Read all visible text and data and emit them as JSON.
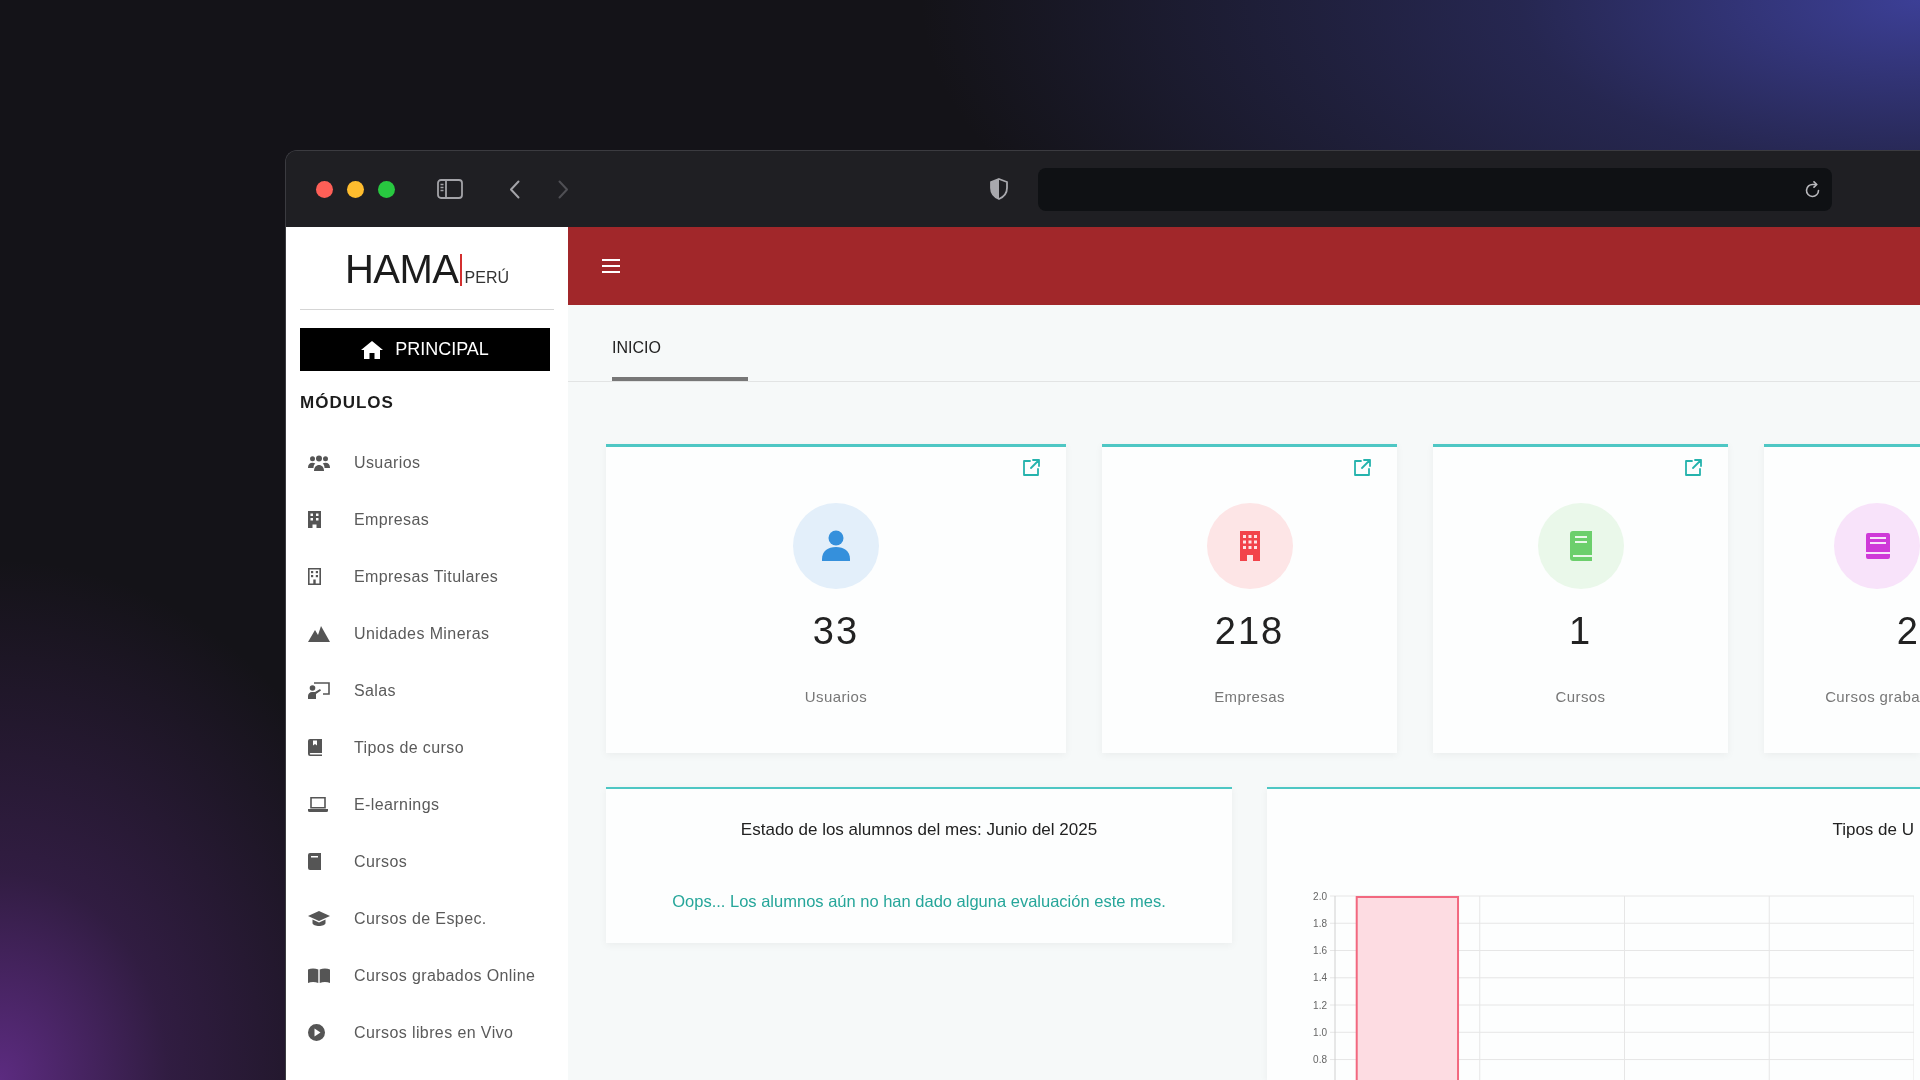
{
  "browser": {
    "back_button": {
      "disabled": false
    },
    "forward_button": {
      "disabled": true
    }
  },
  "sidebar": {
    "logo": {
      "name": "HAMA",
      "region": "PERÚ"
    },
    "home_button": {
      "label": "PRINCIPAL"
    },
    "section_title": "MÓDULOS",
    "items": [
      {
        "label": "Usuarios"
      },
      {
        "label": "Empresas"
      },
      {
        "label": "Empresas Titulares"
      },
      {
        "label": "Unidades Mineras"
      },
      {
        "label": "Salas"
      },
      {
        "label": "Tipos de curso"
      },
      {
        "label": "E-learnings"
      },
      {
        "label": "Cursos"
      },
      {
        "label": "Cursos de Espec."
      },
      {
        "label": "Cursos grabados Online"
      },
      {
        "label": "Cursos libres en Vivo"
      }
    ]
  },
  "tabs": [
    {
      "label": "INICIO",
      "selected": true
    }
  ],
  "cards": [
    {
      "value": "33",
      "label": "Usuarios",
      "color": "#3590dc",
      "link": true
    },
    {
      "value": "218",
      "label": "Empresas",
      "color": "#f2434a",
      "link": true
    },
    {
      "value": "1",
      "label": "Cursos",
      "color": "#6ccf6c",
      "link": true
    },
    {
      "value": "2",
      "label": "Cursos graba",
      "color": "#cf39d8",
      "link": false
    }
  ],
  "panels": [
    {
      "kind": "message",
      "title": "Estado de los alumnos del mes: Junio del 2025",
      "message": "Oops... Los alumnos aún no han dado alguna evaluación este mes."
    },
    {
      "kind": "chart",
      "title": "Tipos de U",
      "chart_data": {
        "type": "bar",
        "grid": true,
        "values": [
          2,
          null,
          null,
          null
        ],
        "ylim": [
          0.65,
          2
        ],
        "yticks": [
          {
            "value": 2,
            "label": "2.0"
          },
          {
            "value": 1.8,
            "label": "1.8"
          },
          {
            "value": 1.6,
            "label": "1.6"
          },
          {
            "value": 1.4,
            "label": "1.4"
          },
          {
            "value": 1.2,
            "label": "1.2"
          },
          {
            "value": 1,
            "label": "1.0"
          },
          {
            "value": 0.8,
            "label": "0.8"
          }
        ]
      }
    }
  ]
}
